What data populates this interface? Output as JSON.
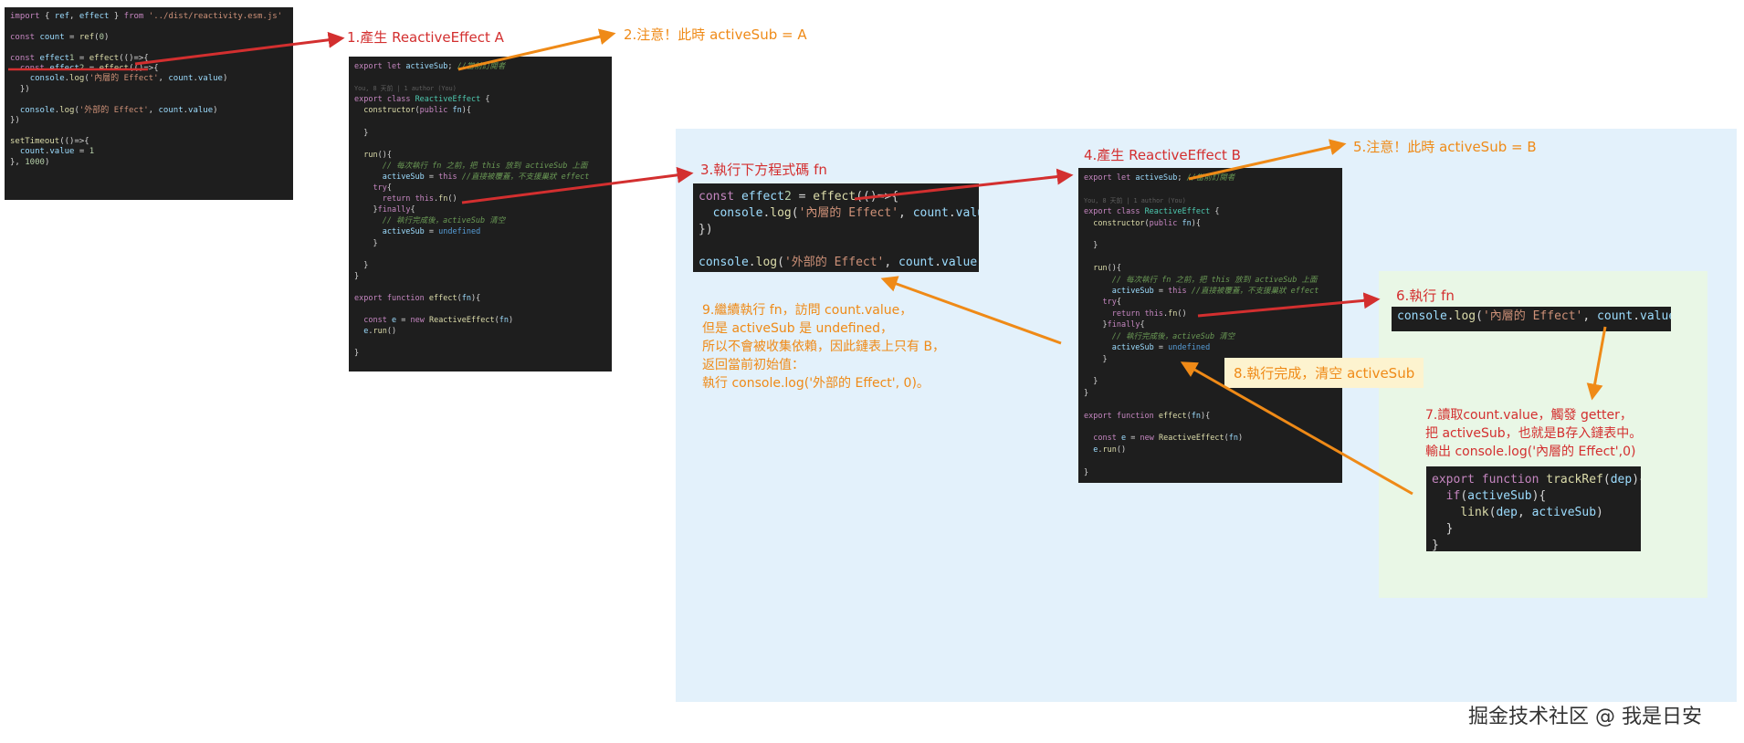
{
  "labels": {
    "step1": "1.產生 ReactiveEffect A",
    "step2": "2.注意！此時 activeSub = A",
    "step3": "3.執行下方程式碼 fn",
    "step4": "4.產生 ReactiveEffect B",
    "step5": "5.注意！此時 activeSub = B",
    "step6": "6.執行 fn",
    "step7": [
      "7.讀取count.value，觸發 getter，",
      "把 activeSub，也就是B存入鏈表中。",
      "輸出 console.log('內層的 Effect',0)"
    ],
    "step8": "8.執行完成，清空 activeSub",
    "step9": [
      "9.繼續執行 fn，訪問 count.value，",
      "但是 activeSub 是 undefined，",
      "所以不會被收集依賴，因此鏈表上只有 B，",
      "返回當前初始值：",
      "執行 console.log('外部的 Effect', 0)。"
    ]
  },
  "watermark": "掘金技术社区 @ 我是日安",
  "colors": {
    "red": "#d32f2f",
    "orange": "#ef8a17",
    "blue_region": "#e3f1fb",
    "green_region": "#e9f7e6",
    "note_bg": "#fdf3cf"
  },
  "code_main": [
    "import { ref, effect } from '../dist/reactivity.esm.js'",
    "",
    "const count = ref(0)",
    "",
    "const effect1 = effect(()=>{",
    "  const effect2 = effect(()=>{",
    "    console.log('內層的 Effect', count.value)",
    "  })",
    "",
    "  console.log('外部的 Effect', count.value)",
    "})",
    "",
    "setTimeout(()=>{",
    "  count.value = 1",
    "}, 1000)"
  ],
  "code_effect_a": [
    "export let activeSub; //當前訂閱者",
    "",
    "You, 8 天前 | 1 author (You)",
    "export class ReactiveEffect {",
    "  constructor(public fn){",
    "",
    "  }",
    "",
    "  run(){",
    "      // 每次執行 fn 之前，把 this 放到 activeSub 上面",
    "      activeSub = this //直接被覆蓋，不支援巢狀 effect",
    "    try{",
    "      return this.fn()",
    "    }finally{",
    "      // 執行完成後，activeSub 清空",
    "      activeSub = undefined",
    "    }",
    "",
    "  }",
    "}",
    "",
    "export function effect(fn){",
    "",
    "  const e = new ReactiveEffect(fn)",
    "  e.run()",
    "",
    "}"
  ],
  "code_snippet": [
    "const effect2 = effect(()=>{",
    "  console.log('內層的 Effect', count.value)",
    "})",
    "",
    "console.log('外部的 Effect', count.value)"
  ],
  "code_effect_b": [
    "export let activeSub; //當前訂閱者",
    "",
    "You, 8 天前 | 1 author (You)",
    "export class ReactiveEffect {",
    "  constructor(public fn){",
    "",
    "  }",
    "",
    "  run(){",
    "      // 每次執行 fn 之前，把 this 放到 activeSub 上面",
    "      activeSub = this //直接被覆蓋，不支援巢狀 effect",
    "    try{",
    "      return this.fn()",
    "    }finally{",
    "      // 執行完成後，activeSub 清空",
    "      activeSub = undefined",
    "    }",
    "",
    "  }",
    "}",
    "",
    "export function effect(fn){",
    "",
    "  const e = new ReactiveEffect(fn)",
    "  e.run()",
    "",
    "}"
  ],
  "code_inner": [
    "console.log('內層的 Effect', count.value)"
  ],
  "code_trackref": [
    "export function trackRef(dep){",
    "  if(activeSub){",
    "    link(dep, activeSub)",
    "  }",
    "}"
  ]
}
